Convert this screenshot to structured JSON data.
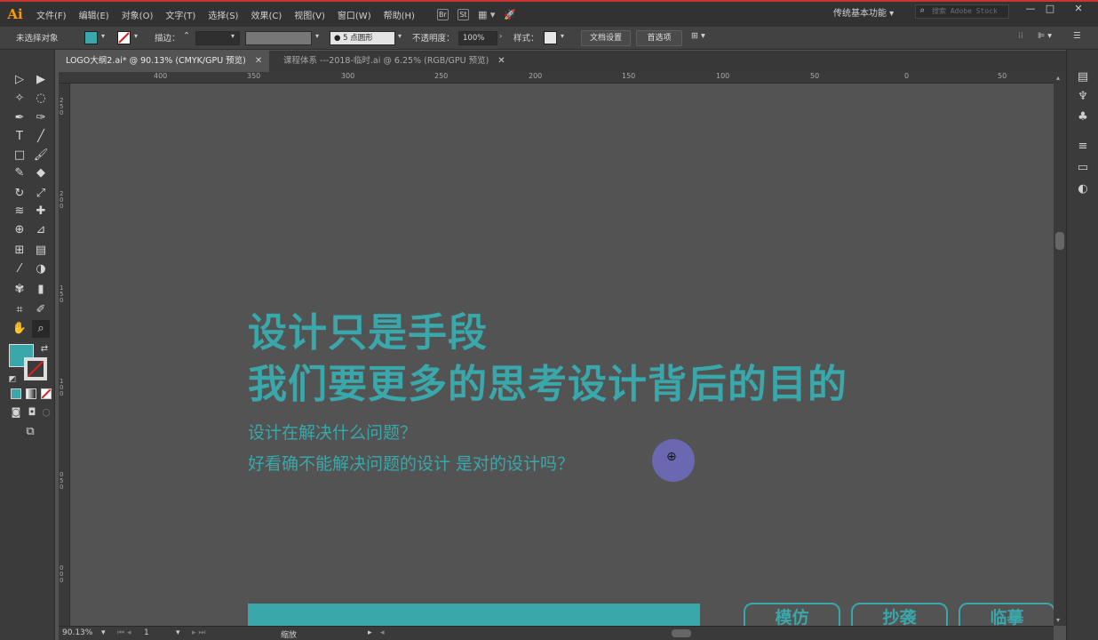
{
  "app": {
    "logo": "Ai"
  },
  "menu": {
    "items": [
      "文件(F)",
      "编辑(E)",
      "对象(O)",
      "文字(T)",
      "选择(S)",
      "效果(C)",
      "视图(V)",
      "窗口(W)",
      "帮助(H)"
    ],
    "bridge_icon": "Br",
    "stock_icon": "St",
    "workspace": "传统基本功能",
    "stock_search_placeholder": "搜索 Adobe Stock",
    "window_buttons": {
      "minimize": "—",
      "maximize": "□",
      "close": "✕"
    }
  },
  "control_bar": {
    "selection_status": "未选择对象",
    "stroke_label": "描边：",
    "brush_label": "5 点圆形",
    "opacity_label": "不透明度：",
    "opacity_value": "100%",
    "style_label": "样式：",
    "doc_setup_button": "文档设置",
    "preferences_button": "首选项",
    "fill_color": "#3aa7aa"
  },
  "tabs": [
    {
      "label": "LOGO大纲2.ai* @ 90.13% (CMYK/GPU 预览)",
      "active": true
    },
    {
      "label": "课程体系 ---2018-临时.ai @ 6.25% (RGB/GPU 预览)",
      "active": false
    }
  ],
  "ruler": {
    "top_labels": [
      "400",
      "350",
      "300",
      "250",
      "200",
      "150",
      "100",
      "50",
      "0",
      "50"
    ],
    "left_labels": [
      "250",
      "200",
      "150",
      "100",
      "050",
      "000"
    ]
  },
  "canvas": {
    "headline_1": "设计只是手段",
    "headline_2": "我们要更多的思考设计背后的目的",
    "subline_1": "设计在解决什么问题？",
    "subline_2": "好看确不能解决问题的设计 是对的设计吗？",
    "buttons": [
      "模仿",
      "抄袭",
      "临摹"
    ],
    "accent_color": "#3aa7aa"
  },
  "status_bar": {
    "zoom": "90.13%",
    "artboard": "1",
    "tool_name": "缩放"
  },
  "icons": {
    "menu": [
      "bridge-icon",
      "stock-icon",
      "arrange-documents-icon",
      "gpu-performance-icon"
    ],
    "tools": [
      "selection-tool-icon",
      "direct-selection-tool-icon",
      "magic-wand-icon",
      "lasso-icon",
      "pen-tool-icon",
      "curvature-tool-icon",
      "type-tool-icon",
      "line-tool-icon",
      "rectangle-tool-icon",
      "paintbrush-icon",
      "shaper-tool-icon",
      "eraser-icon",
      "rotate-tool-icon",
      "scale-tool-icon",
      "width-tool-icon",
      "puppet-warp-icon",
      "shape-builder-icon",
      "perspective-grid-icon",
      "mesh-tool-icon",
      "gradient-tool-icon",
      "eyedropper-icon",
      "blend-tool-icon",
      "symbol-sprayer-icon",
      "graph-tool-icon",
      "artboard-tool-icon",
      "slice-tool-icon",
      "hand-tool-icon",
      "zoom-tool-icon"
    ],
    "right_panel": [
      "libraries-icon",
      "symbols-icon",
      "club-icon",
      "layers-icon",
      "gradient-panel-icon",
      "appearance-icon"
    ]
  }
}
